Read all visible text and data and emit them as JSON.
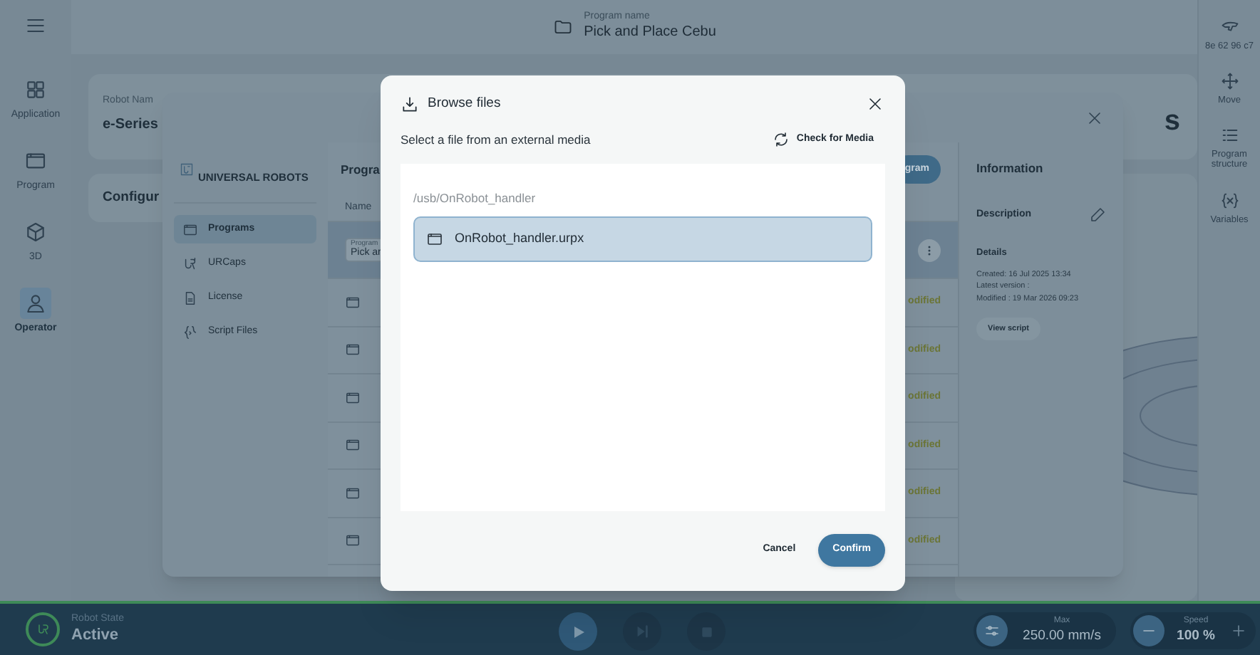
{
  "top_bar": {
    "label": "Program name",
    "program_name": "Pick and Place Cebu"
  },
  "left_nav": [
    {
      "label": "Application",
      "selected": false
    },
    {
      "label": "Program",
      "selected": false
    },
    {
      "label": "3D",
      "selected": false
    },
    {
      "label": "Operator",
      "selected": true
    }
  ],
  "right_nav": [
    {
      "label": "8e 62 96 c7"
    },
    {
      "label": "Move"
    },
    {
      "label": "Program structure"
    },
    {
      "label": "Variables"
    }
  ],
  "background": {
    "robot_name_label": "Robot Nam",
    "robot_name": "e-Series",
    "configuration": "Configur",
    "title_fragment": "s"
  },
  "program_manager": {
    "brand": "UNIVERSAL ROBOTS",
    "menu": [
      {
        "label": "Programs",
        "selected": true
      },
      {
        "label": "URCaps",
        "selected": false
      },
      {
        "label": "License",
        "selected": false
      },
      {
        "label": "Script Files",
        "selected": false
      }
    ],
    "heading": "Progra",
    "column": "Name",
    "new_button": "gram",
    "rows": [
      {
        "kind": "program",
        "label": "Program",
        "name": "Pick ar",
        "selected": true
      },
      {
        "kind": "file",
        "status": "odified",
        "selected": false
      },
      {
        "kind": "file",
        "status": "odified",
        "selected": false
      },
      {
        "kind": "file",
        "status": "odified",
        "selected": false
      },
      {
        "kind": "file",
        "status": "odified",
        "selected": false
      },
      {
        "kind": "file",
        "status": "odified",
        "selected": false
      },
      {
        "kind": "file",
        "status": "odified",
        "selected": false
      }
    ],
    "info": {
      "title": "Information",
      "description": "Description",
      "details": "Details",
      "lines": [
        "Created: 16 Jul 2025 13:34",
        "Latest version :",
        "Modified : 19 Mar 2026 09:23"
      ],
      "view_script": "View script"
    }
  },
  "browse_dialog": {
    "title": "Browse files",
    "subtitle": "Select a file from an external media",
    "check_media": "Check for Media",
    "path": "/usb/OnRobot_handler",
    "files": [
      {
        "name": "OnRobot_handler.urpx",
        "selected": true
      }
    ],
    "cancel": "Cancel",
    "confirm": "Confirm"
  },
  "status_bar": {
    "state_label": "Robot State",
    "state": "Active",
    "max_label": "Max",
    "max_value": "250.00 mm/s",
    "speed_label": "Speed",
    "speed_value": "100 %"
  }
}
